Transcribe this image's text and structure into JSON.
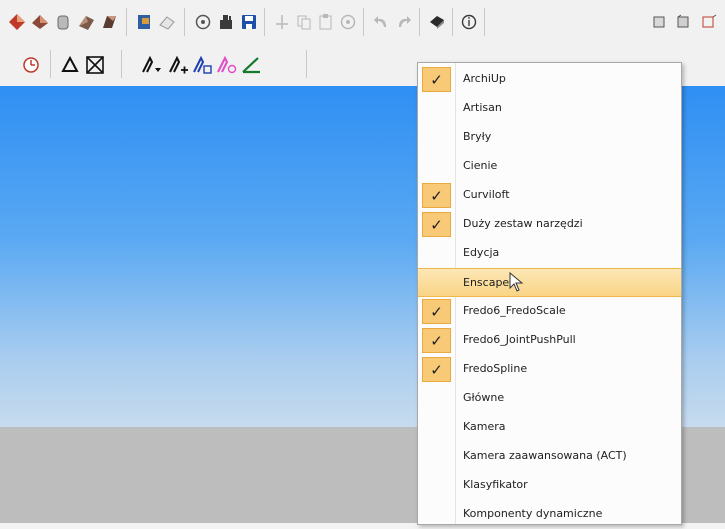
{
  "menu": {
    "items": [
      {
        "label": "ArchiUp",
        "checked": true
      },
      {
        "label": "Artisan",
        "checked": false
      },
      {
        "label": "Bryły",
        "checked": false
      },
      {
        "label": "Cienie",
        "checked": false
      },
      {
        "label": "Curviloft",
        "checked": true
      },
      {
        "label": "Duży zestaw narzędzi",
        "checked": true
      },
      {
        "label": "Edycja",
        "checked": false
      },
      {
        "label": "Enscape",
        "checked": false
      },
      {
        "label": "Fredo6_FredoScale",
        "checked": true
      },
      {
        "label": "Fredo6_JointPushPull",
        "checked": true
      },
      {
        "label": "FredoSpline",
        "checked": true
      },
      {
        "label": "Główne",
        "checked": false
      },
      {
        "label": "Kamera",
        "checked": false
      },
      {
        "label": "Kamera zaawansowana (ACT)",
        "checked": false
      },
      {
        "label": "Klasyfikator",
        "checked": false
      },
      {
        "label": "Komponenty dynamiczne",
        "checked": false
      }
    ],
    "highlighted_index": 7,
    "check_glyph": "✓"
  },
  "colors": {
    "check_bg": "#f8c976",
    "highlight": "#f9d486",
    "sky": "#2f8ff3",
    "ground": "#bdbdbd"
  },
  "toolbar_row1_icons": [
    "sandbox-red-icon",
    "sandbox-brown-icon",
    "sandbox-grey-icon",
    "sandbox-dark-icon",
    "sandbox-flip-icon",
    "book-icon",
    "eraser-icon",
    "new-icon",
    "open-icon",
    "save-icon",
    "cut-icon",
    "copy-icon",
    "paste-icon",
    "delete-icon",
    "undo-icon",
    "redo-icon",
    "print-icon",
    "model-info-icon",
    "view-iso-icon",
    "view-top-icon",
    "view-front-icon"
  ],
  "toolbar_row2_icons": [
    "shadow-clock-icon",
    "delta-icon",
    "hourglass-icon",
    "section-plane-icon",
    "add-line-icon",
    "edit-line-icon",
    "smooth-line-icon",
    "angle-icon"
  ]
}
